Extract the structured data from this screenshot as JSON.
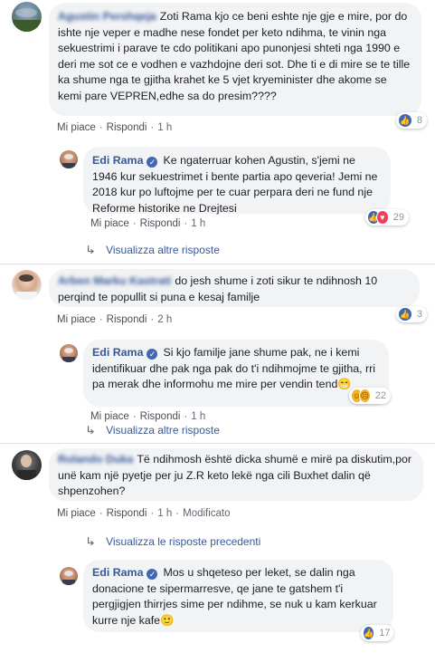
{
  "comments": [
    {
      "author": "Agustin Pershqeja",
      "text": "Zoti Rama kjo ce beni eshte nje gje e mire, por do ishte nje veper e madhe nese fondet per keto ndihma, te vinin nga sekuestrimi i parave te cdo politikani apo punonjesi shteti nga 1990 e deri me sot ce e vodhen e vazhdojne deri sot. Dhe ti e di mire se te tille ka shume nga te gjitha krahet ke 5 vjet kryeminister dhe akome se kemi pare VEPREN,edhe sa do presim????",
      "like": "Mi piace",
      "reply": "Rispondi",
      "time": "1 h",
      "reactions": "8",
      "reply_item": {
        "author": "Edi Rama",
        "text": "Ke ngaterruar kohen Agustin, s'jemi ne 1946 kur sekuestrimet i bente partia apo qeveria! Jemi ne 2018 kur po luftojme per te cuar perpara deri ne fund nje Reforme historike ne Drejtesi",
        "like": "Mi piace",
        "reply": "Rispondi",
        "time": "1 h",
        "reactions": "29"
      },
      "more": "Visualizza altre risposte"
    },
    {
      "author": "Arben Marku Kastrati",
      "text": "do jesh shume i zoti sikur te ndihnosh 10 perqind te popullit si puna e kesaj familje",
      "like": "Mi piace",
      "reply": "Rispondi",
      "time": "2 h",
      "reactions": "3",
      "reply_item": {
        "author": "Edi Rama",
        "text": "Si kjo familje jane shume pak, ne i kemi identifikuar dhe pak nga pak do t'i ndihmojme te gjitha, rri pa merak dhe informohu me mire per vendin tend",
        "emoji": "😁",
        "like": "Mi piace",
        "reply": "Rispondi",
        "time": "1 h",
        "reactions": "22"
      },
      "more": "Visualizza altre risposte"
    },
    {
      "author": "Rolando Duka",
      "text": "Të ndihmosh është dicka shumë e mirë pa diskutim,por unë kam një pyetje per ju Z.R keto lekë nga cili Buxhet dalin që shpenzohen?",
      "like": "Mi piace",
      "reply": "Rispondi",
      "time": "1 h",
      "modified": "Modificato",
      "more": "Visualizza le risposte precedenti",
      "reply_item": {
        "author": "Edi Rama",
        "text": "Mos u shqeteso per leket, se dalin nga donacione te sipermarresve, qe jane te gatshem t'i pergjigjen thirrjes sime per ndihme, se nuk u kam kerkuar kurre nje kafe",
        "emoji": "🙂",
        "reactions": "17"
      }
    }
  ],
  "icons": {
    "like": "like-icon",
    "love": "love-icon",
    "haha": "haha-icon",
    "sad": "sad-icon",
    "verified": "verified-badge-icon",
    "reply_arrow": "reply-arrow-icon"
  },
  "colors": {
    "link": "#385898",
    "bubble": "#f2f3f5",
    "like": "#4267b2",
    "love": "#f33e58"
  }
}
